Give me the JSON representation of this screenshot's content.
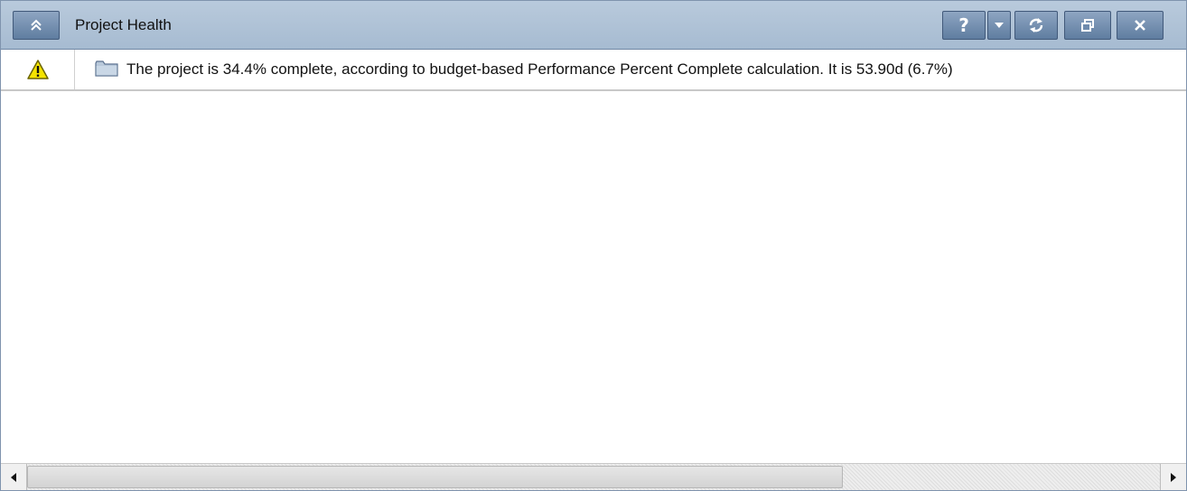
{
  "window": {
    "title": "Project Health",
    "buttons": {
      "collapse_icon": "double-chevron-up-icon",
      "help_label": "?",
      "dropdown_icon": "chevron-down-icon",
      "refresh_icon": "refresh-icon",
      "restore_icon": "restore-window-icon",
      "close_icon": "close-icon"
    }
  },
  "rows": [
    {
      "status_icon": "warning-icon",
      "type_icon": "folder-icon",
      "message": "The project is 34.4% complete, according to budget-based Performance Percent Complete calculation. It is 53.90d (6.7%)"
    }
  ],
  "scrollbar": {
    "horizontal_visible_fraction": 0.72,
    "horizontal_position_fraction": 0.0
  },
  "colors": {
    "titlebar": "#a6bbd1",
    "button": "#6f8bad",
    "warning": "#f5e400"
  }
}
